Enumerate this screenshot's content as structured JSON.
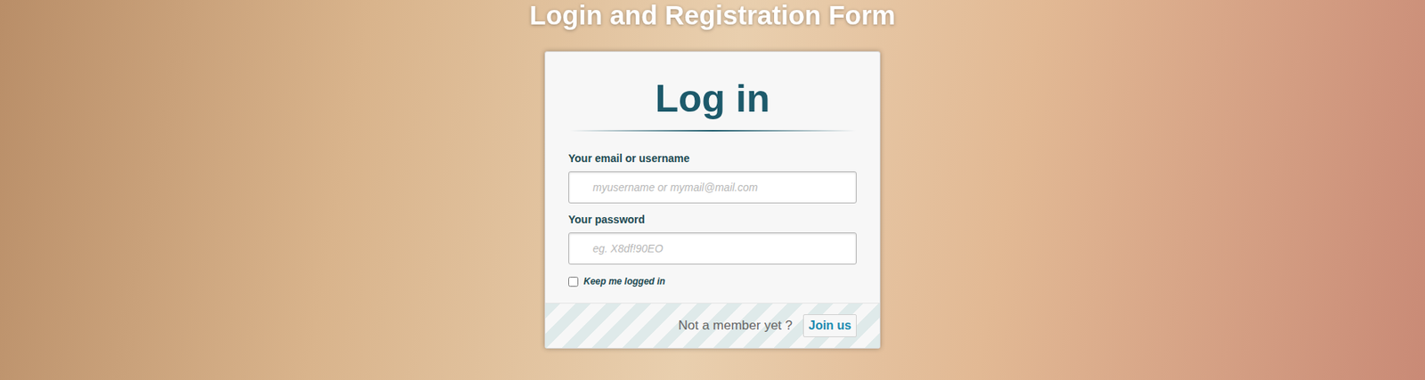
{
  "page": {
    "title": "Login and Registration Form"
  },
  "form": {
    "heading": "Log in",
    "fields": [
      {
        "label": "Your email or username",
        "placeholder": "myusername or mymail@mail.com",
        "type": "text"
      },
      {
        "label": "Your password",
        "placeholder": "eg. X8df!90EO",
        "type": "password"
      }
    ],
    "remember": {
      "label": "Keep me logged in",
      "checked": false
    },
    "footer": {
      "text": "Not a member yet ?",
      "link": "Join us"
    }
  }
}
